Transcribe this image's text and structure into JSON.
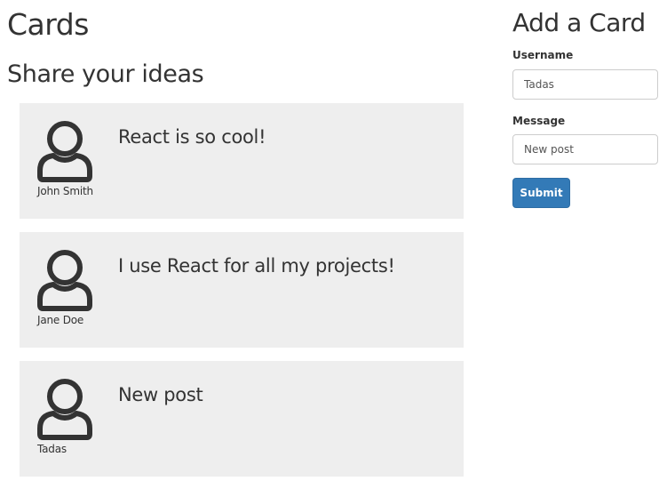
{
  "header": {
    "title": "Cards",
    "subtitle": "Share your ideas"
  },
  "cards": [
    {
      "username": "John Smith",
      "message": "React is so cool!",
      "icon": "user-avatar-icon"
    },
    {
      "username": "Jane Doe",
      "message": "I use React for all my projects!",
      "icon": "user-avatar-icon"
    },
    {
      "username": "Tadas",
      "message": "New post",
      "icon": "user-avatar-icon"
    }
  ],
  "form": {
    "title": "Add a Card",
    "username_label": "Username",
    "username_value": "Tadas",
    "message_label": "Message",
    "message_value": "New post",
    "submit_label": "Submit"
  },
  "colors": {
    "card_background": "#eeeeee",
    "submit_button": "#337ab7",
    "text": "#333333"
  }
}
